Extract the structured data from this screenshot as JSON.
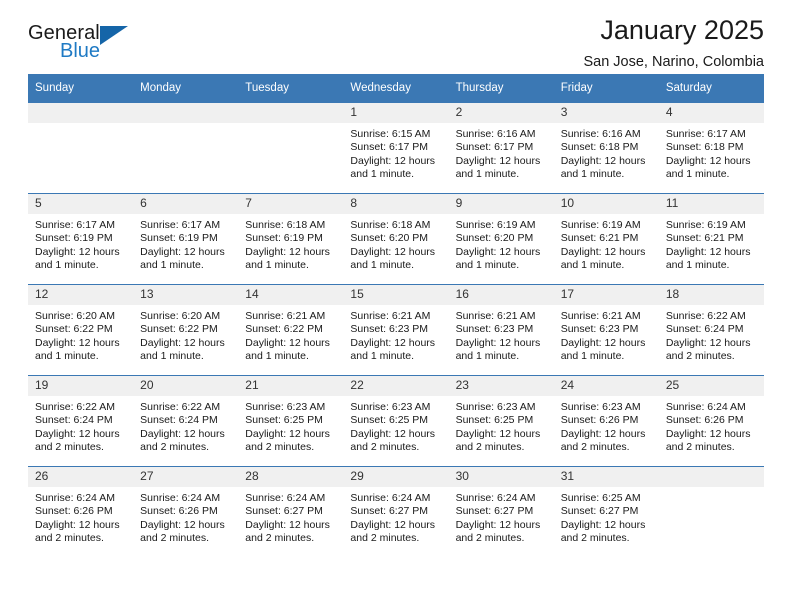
{
  "brand": {
    "name_part1": "General",
    "name_part2": "Blue",
    "color_dark": "#1a1a1a",
    "color_blue": "#1f7ac4",
    "triangle_color": "#1565a8"
  },
  "header": {
    "title": "January 2025",
    "subtitle": "San Jose, Narino, Colombia"
  },
  "theme": {
    "header_bg": "#3b78b4",
    "header_text": "#ffffff",
    "daynum_bg": "#f0f0f0",
    "grid_line": "#3b78b4"
  },
  "weekdays": [
    "Sunday",
    "Monday",
    "Tuesday",
    "Wednesday",
    "Thursday",
    "Friday",
    "Saturday"
  ],
  "labels": {
    "sunrise": "Sunrise:",
    "sunset": "Sunset:",
    "daylight": "Daylight:"
  },
  "weeks": [
    [
      {
        "day": ""
      },
      {
        "day": ""
      },
      {
        "day": ""
      },
      {
        "day": "1",
        "sunrise": "Sunrise: 6:15 AM",
        "sunset": "Sunset: 6:17 PM",
        "daylight": "Daylight: 12 hours and 1 minute."
      },
      {
        "day": "2",
        "sunrise": "Sunrise: 6:16 AM",
        "sunset": "Sunset: 6:17 PM",
        "daylight": "Daylight: 12 hours and 1 minute."
      },
      {
        "day": "3",
        "sunrise": "Sunrise: 6:16 AM",
        "sunset": "Sunset: 6:18 PM",
        "daylight": "Daylight: 12 hours and 1 minute."
      },
      {
        "day": "4",
        "sunrise": "Sunrise: 6:17 AM",
        "sunset": "Sunset: 6:18 PM",
        "daylight": "Daylight: 12 hours and 1 minute."
      }
    ],
    [
      {
        "day": "5",
        "sunrise": "Sunrise: 6:17 AM",
        "sunset": "Sunset: 6:19 PM",
        "daylight": "Daylight: 12 hours and 1 minute."
      },
      {
        "day": "6",
        "sunrise": "Sunrise: 6:17 AM",
        "sunset": "Sunset: 6:19 PM",
        "daylight": "Daylight: 12 hours and 1 minute."
      },
      {
        "day": "7",
        "sunrise": "Sunrise: 6:18 AM",
        "sunset": "Sunset: 6:19 PM",
        "daylight": "Daylight: 12 hours and 1 minute."
      },
      {
        "day": "8",
        "sunrise": "Sunrise: 6:18 AM",
        "sunset": "Sunset: 6:20 PM",
        "daylight": "Daylight: 12 hours and 1 minute."
      },
      {
        "day": "9",
        "sunrise": "Sunrise: 6:19 AM",
        "sunset": "Sunset: 6:20 PM",
        "daylight": "Daylight: 12 hours and 1 minute."
      },
      {
        "day": "10",
        "sunrise": "Sunrise: 6:19 AM",
        "sunset": "Sunset: 6:21 PM",
        "daylight": "Daylight: 12 hours and 1 minute."
      },
      {
        "day": "11",
        "sunrise": "Sunrise: 6:19 AM",
        "sunset": "Sunset: 6:21 PM",
        "daylight": "Daylight: 12 hours and 1 minute."
      }
    ],
    [
      {
        "day": "12",
        "sunrise": "Sunrise: 6:20 AM",
        "sunset": "Sunset: 6:22 PM",
        "daylight": "Daylight: 12 hours and 1 minute."
      },
      {
        "day": "13",
        "sunrise": "Sunrise: 6:20 AM",
        "sunset": "Sunset: 6:22 PM",
        "daylight": "Daylight: 12 hours and 1 minute."
      },
      {
        "day": "14",
        "sunrise": "Sunrise: 6:21 AM",
        "sunset": "Sunset: 6:22 PM",
        "daylight": "Daylight: 12 hours and 1 minute."
      },
      {
        "day": "15",
        "sunrise": "Sunrise: 6:21 AM",
        "sunset": "Sunset: 6:23 PM",
        "daylight": "Daylight: 12 hours and 1 minute."
      },
      {
        "day": "16",
        "sunrise": "Sunrise: 6:21 AM",
        "sunset": "Sunset: 6:23 PM",
        "daylight": "Daylight: 12 hours and 1 minute."
      },
      {
        "day": "17",
        "sunrise": "Sunrise: 6:21 AM",
        "sunset": "Sunset: 6:23 PM",
        "daylight": "Daylight: 12 hours and 1 minute."
      },
      {
        "day": "18",
        "sunrise": "Sunrise: 6:22 AM",
        "sunset": "Sunset: 6:24 PM",
        "daylight": "Daylight: 12 hours and 2 minutes."
      }
    ],
    [
      {
        "day": "19",
        "sunrise": "Sunrise: 6:22 AM",
        "sunset": "Sunset: 6:24 PM",
        "daylight": "Daylight: 12 hours and 2 minutes."
      },
      {
        "day": "20",
        "sunrise": "Sunrise: 6:22 AM",
        "sunset": "Sunset: 6:24 PM",
        "daylight": "Daylight: 12 hours and 2 minutes."
      },
      {
        "day": "21",
        "sunrise": "Sunrise: 6:23 AM",
        "sunset": "Sunset: 6:25 PM",
        "daylight": "Daylight: 12 hours and 2 minutes."
      },
      {
        "day": "22",
        "sunrise": "Sunrise: 6:23 AM",
        "sunset": "Sunset: 6:25 PM",
        "daylight": "Daylight: 12 hours and 2 minutes."
      },
      {
        "day": "23",
        "sunrise": "Sunrise: 6:23 AM",
        "sunset": "Sunset: 6:25 PM",
        "daylight": "Daylight: 12 hours and 2 minutes."
      },
      {
        "day": "24",
        "sunrise": "Sunrise: 6:23 AM",
        "sunset": "Sunset: 6:26 PM",
        "daylight": "Daylight: 12 hours and 2 minutes."
      },
      {
        "day": "25",
        "sunrise": "Sunrise: 6:24 AM",
        "sunset": "Sunset: 6:26 PM",
        "daylight": "Daylight: 12 hours and 2 minutes."
      }
    ],
    [
      {
        "day": "26",
        "sunrise": "Sunrise: 6:24 AM",
        "sunset": "Sunset: 6:26 PM",
        "daylight": "Daylight: 12 hours and 2 minutes."
      },
      {
        "day": "27",
        "sunrise": "Sunrise: 6:24 AM",
        "sunset": "Sunset: 6:26 PM",
        "daylight": "Daylight: 12 hours and 2 minutes."
      },
      {
        "day": "28",
        "sunrise": "Sunrise: 6:24 AM",
        "sunset": "Sunset: 6:27 PM",
        "daylight": "Daylight: 12 hours and 2 minutes."
      },
      {
        "day": "29",
        "sunrise": "Sunrise: 6:24 AM",
        "sunset": "Sunset: 6:27 PM",
        "daylight": "Daylight: 12 hours and 2 minutes."
      },
      {
        "day": "30",
        "sunrise": "Sunrise: 6:24 AM",
        "sunset": "Sunset: 6:27 PM",
        "daylight": "Daylight: 12 hours and 2 minutes."
      },
      {
        "day": "31",
        "sunrise": "Sunrise: 6:25 AM",
        "sunset": "Sunset: 6:27 PM",
        "daylight": "Daylight: 12 hours and 2 minutes."
      },
      {
        "day": ""
      }
    ]
  ]
}
